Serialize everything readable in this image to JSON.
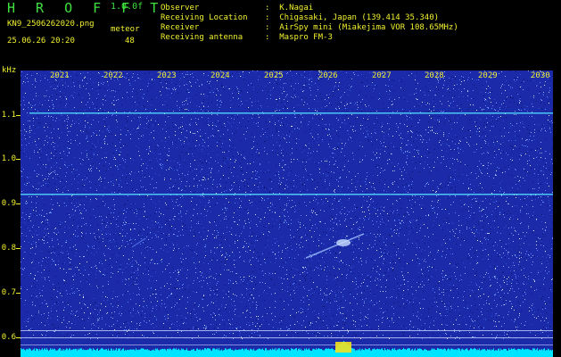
{
  "header": {
    "title": "H R O F F T",
    "version": "1.0.0f",
    "filename": "KN9_2506262020.png",
    "mode": "meteor",
    "datetime": "25.06.26 20:20",
    "count": "48"
  },
  "info": [
    {
      "label": "Observer",
      "value": ":  K.Nagai"
    },
    {
      "label": "Receiving Location",
      "value": ":  Chigasaki, Japan (139.414 35.340)"
    },
    {
      "label": "Receiver",
      "value": ":  AirSpy mini (Miakejima VOR 108.65MHz)"
    },
    {
      "label": "Receiving antenna",
      "value": ":  Maspro FM-3"
    }
  ],
  "axes": {
    "y_unit": "kHz",
    "y_ticks": [
      "1.1",
      "1.0",
      "0.9",
      "0.8",
      "0.7",
      "0.6"
    ],
    "x_ticks": [
      "2021",
      "2022",
      "2023",
      "2024",
      "2025",
      "2026",
      "2027",
      "2028",
      "2029",
      "2030"
    ]
  },
  "colors": {
    "background": "#000000",
    "plot": "#1a2aa8",
    "text": "#f0f030",
    "title": "#3fe03f",
    "carrier": "#4fd6ff",
    "noise_floor": "#00e5ff"
  }
}
